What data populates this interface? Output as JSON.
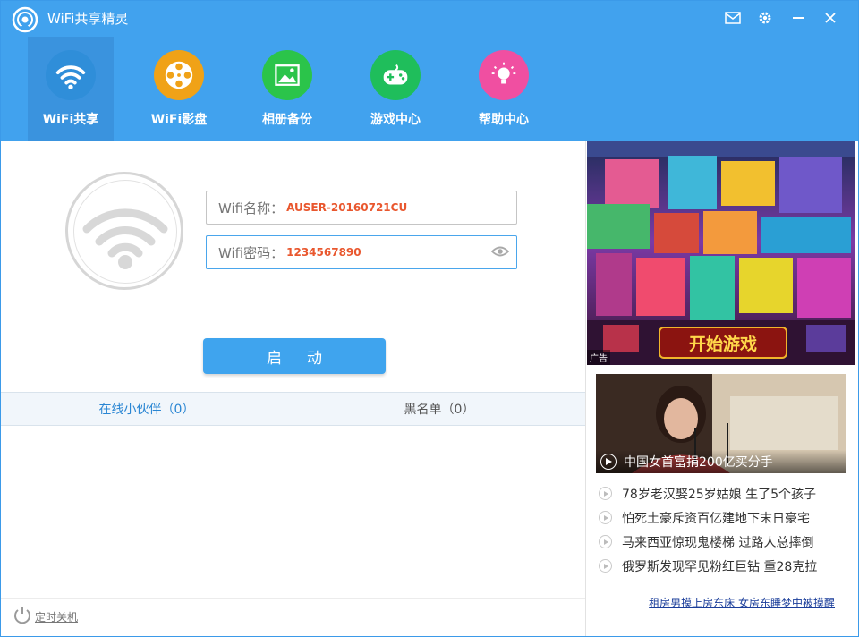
{
  "app": {
    "title": "WiFi共享精灵"
  },
  "tabs": [
    {
      "label": "WiFi共享",
      "icon": "wifi-icon",
      "color": "#2f8ed9"
    },
    {
      "label": "WiFi影盘",
      "icon": "film-reel-icon",
      "color": "#f0a217"
    },
    {
      "label": "相册备份",
      "icon": "photo-icon",
      "color": "#2bc44a"
    },
    {
      "label": "游戏中心",
      "icon": "gamepad-icon",
      "color": "#1fbe5b"
    },
    {
      "label": "帮助中心",
      "icon": "lightbulb-icon",
      "color": "#f04fa1"
    }
  ],
  "wifi": {
    "name_label": "Wifi名称：",
    "name_value": "AUSER-20160721CU",
    "password_label": "Wifi密码：",
    "password_value": "1234567890",
    "start_button": "启动"
  },
  "subtabs": {
    "online": "在线小伙伴（0）",
    "blacklist": "黑名单（0）"
  },
  "ad": {
    "tag": "广告",
    "button": "开始游戏"
  },
  "photo_news": {
    "caption": "中国女首富捐200亿买分手"
  },
  "news": [
    "78岁老汉娶25岁姑娘 生了5个孩子",
    "怕死土豪斥资百亿建地下末日豪宅",
    "马来西亚惊现鬼楼梯 过路人总摔倒",
    "俄罗斯发现罕见粉红巨钻 重28克拉"
  ],
  "bottom_link": "租房男摸上房东床 女房东睡梦中被摸醒",
  "footer": {
    "timer_label": "定时关机"
  }
}
